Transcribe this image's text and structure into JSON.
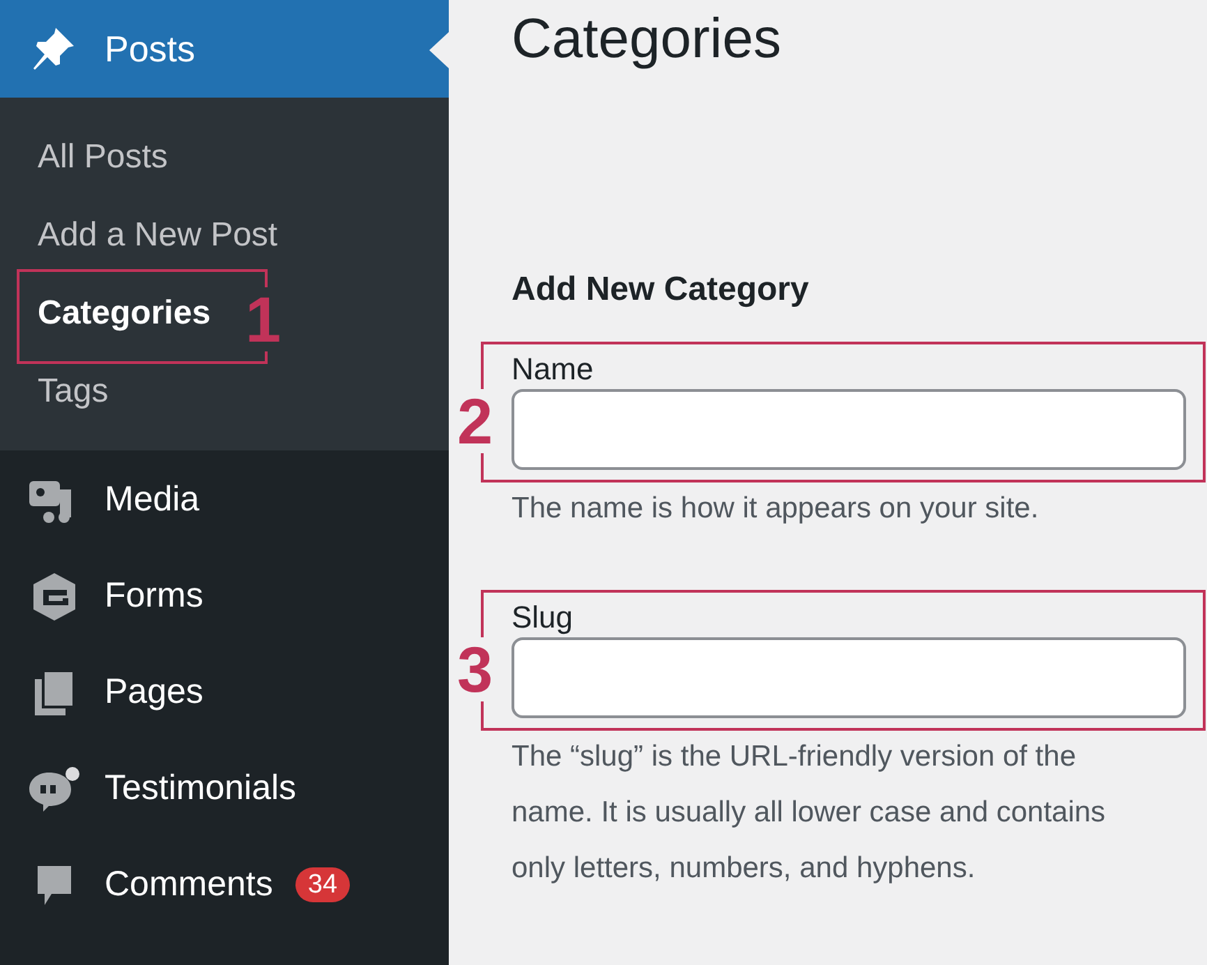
{
  "sidebar": {
    "active_menu": {
      "label": "Posts",
      "kind": "pin"
    },
    "submenu": [
      {
        "label": "All Posts",
        "selected": false
      },
      {
        "label": "Add a New Post",
        "selected": false
      },
      {
        "label": "Categories",
        "selected": true,
        "annotation": "1"
      },
      {
        "label": "Tags",
        "selected": false
      }
    ],
    "items": [
      {
        "label": "Media",
        "kind": "media"
      },
      {
        "label": "Forms",
        "kind": "forms"
      },
      {
        "label": "Pages",
        "kind": "pages"
      },
      {
        "label": "Testimonials",
        "kind": "testimonials"
      },
      {
        "label": "Comments",
        "kind": "comments",
        "badge": "34"
      }
    ]
  },
  "main": {
    "title": "Categories",
    "section_title": "Add New Category",
    "fields": [
      {
        "label": "Name",
        "annotation": "2",
        "help": "The name is how it appears on your site."
      },
      {
        "label": "Slug",
        "annotation": "3",
        "help": "The “slug” is the URL-friendly version of the name. It is usually all lower case and contains only letters, numbers, and hyphens."
      }
    ]
  }
}
